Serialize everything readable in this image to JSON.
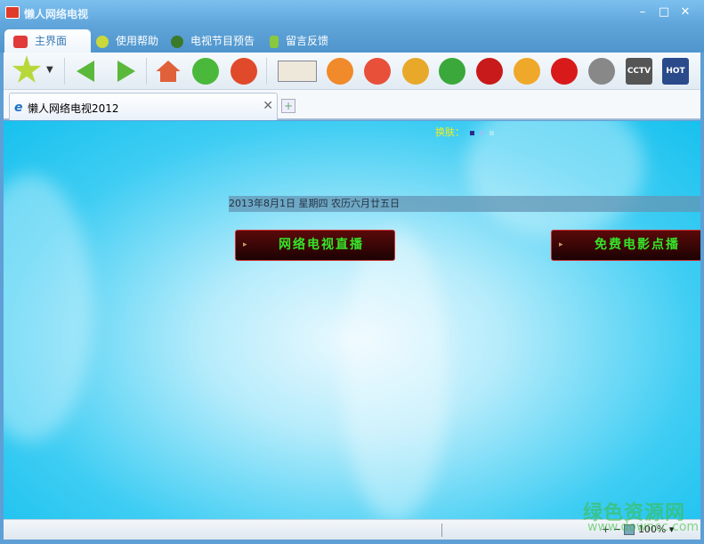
{
  "window": {
    "title": "懒人网络电视",
    "minimize": "–",
    "maximize": "□",
    "close": "✕"
  },
  "menu": [
    {
      "label": "主界面",
      "icon": "clapperboard-icon",
      "color": "#e03a3a"
    },
    {
      "label": "使用帮助",
      "icon": "star-icon",
      "color": "#c9d83a"
    },
    {
      "label": "电视节目预告",
      "icon": "globe-icon",
      "color": "#3a7a2a"
    },
    {
      "label": "留言反馈",
      "icon": "feather-icon",
      "color": "#8ac840"
    }
  ],
  "toolbar": {
    "nav": [
      {
        "name": "favorites-star-icon",
        "color": "#b8d83a"
      },
      {
        "name": "back-icon",
        "color": "#5ab83a"
      },
      {
        "name": "forward-icon",
        "color": "#5ab83a"
      },
      {
        "name": "home-icon",
        "color": "#e0603a"
      },
      {
        "name": "refresh-icon",
        "color": "#4ab83a"
      },
      {
        "name": "stop-icon",
        "color": "#e04a2a"
      }
    ],
    "apps": [
      {
        "name": "qq-mascot-icon",
        "color": "#f08a2a"
      },
      {
        "name": "pptv-icon",
        "color": "#e8503a"
      },
      {
        "name": "sina-icon",
        "color": "#e8a82a"
      },
      {
        "name": "sohu-icon",
        "color": "#3aa83a"
      },
      {
        "name": "fox-icon",
        "color": "#c81a1a"
      },
      {
        "name": "pps-icon",
        "color": "#f0a82a"
      },
      {
        "name": "qvod-icon",
        "color": "#d81a1a"
      },
      {
        "name": "film-icon",
        "color": "#888888"
      },
      {
        "name": "cctv-icon",
        "color": "#555555",
        "label": "CCTV"
      },
      {
        "name": "hot-movie-icon",
        "color": "#2a4a8a",
        "label": "HOT"
      }
    ]
  },
  "tabs": [
    {
      "label": "懒人网络电视2012",
      "close": "✕"
    }
  ],
  "newtab": "+",
  "content": {
    "skin_label": "换肤：",
    "skins": [
      "#2a2a8a",
      "#8ac8f8",
      "#a8e8f0"
    ],
    "date": "2013年8月1日  星期四  农历六月廿五日",
    "buttons": [
      {
        "label": "网络电视直播",
        "arrow": "▸"
      },
      {
        "label": "免费电影点播",
        "arrow": "▸"
      }
    ]
  },
  "status": {
    "zoom": "100%",
    "zoom_in": "+",
    "zoom_out": "−",
    "dropdown": "▾"
  },
  "watermark": {
    "text": "绿色资源网",
    "url": "www.downcc.com"
  }
}
